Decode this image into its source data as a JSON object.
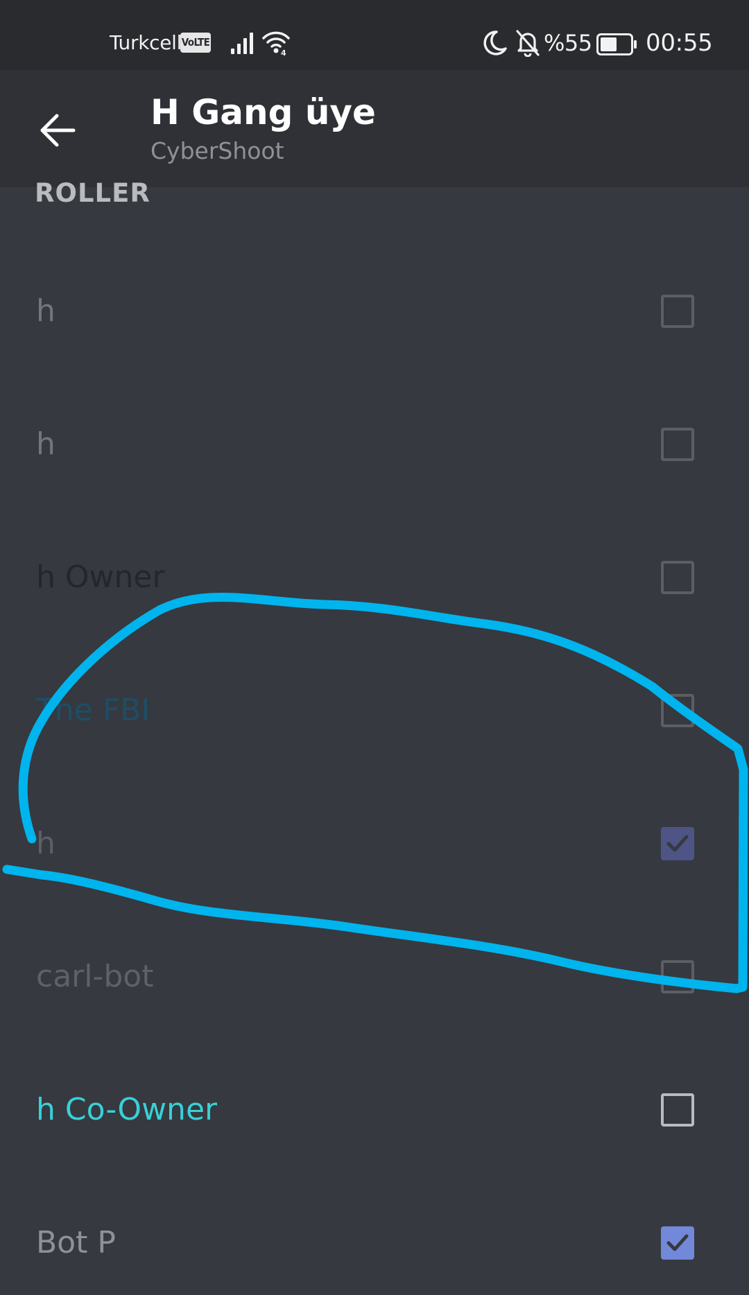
{
  "status_bar": {
    "carrier": "Turkcell",
    "volte_badge": "VoLTE",
    "battery_percent": "%55",
    "battery_level": 0.55,
    "time": "00:55",
    "icons": [
      "signal-icon",
      "wifi-icon",
      "moon-icon",
      "bell-off-icon",
      "battery-icon"
    ]
  },
  "header": {
    "title": "H Gang üye",
    "subtitle": "CyberShoot",
    "back_icon": "arrow-left-icon"
  },
  "roles": {
    "section_label": "ROLLER",
    "items": [
      {
        "name": "h",
        "color": "#72767d",
        "checked": false
      },
      {
        "name": "h",
        "color": "#72767d",
        "checked": false
      },
      {
        "name": "h Owner",
        "color": "#23262b",
        "checked": false
      },
      {
        "name": "The FBI",
        "color": "#1d4e66",
        "checked": false
      },
      {
        "name": "h",
        "color": "#5c5f66",
        "checked": true
      },
      {
        "name": "carl-bot",
        "color": "#5e6168",
        "checked": false
      },
      {
        "name": "h Co-Owner",
        "color": "#39d0d8",
        "checked": false
      },
      {
        "name": "Bot P",
        "color": "#8e9297",
        "checked": true
      }
    ]
  },
  "colors": {
    "background": "#36393f",
    "header_bg": "#2f3136",
    "status_bar_bg": "#2a2b2f",
    "checkbox_checked": "#4e5486",
    "checkbox_checked_bright": "#7289da",
    "annotation_stroke": "#00b4ee"
  }
}
